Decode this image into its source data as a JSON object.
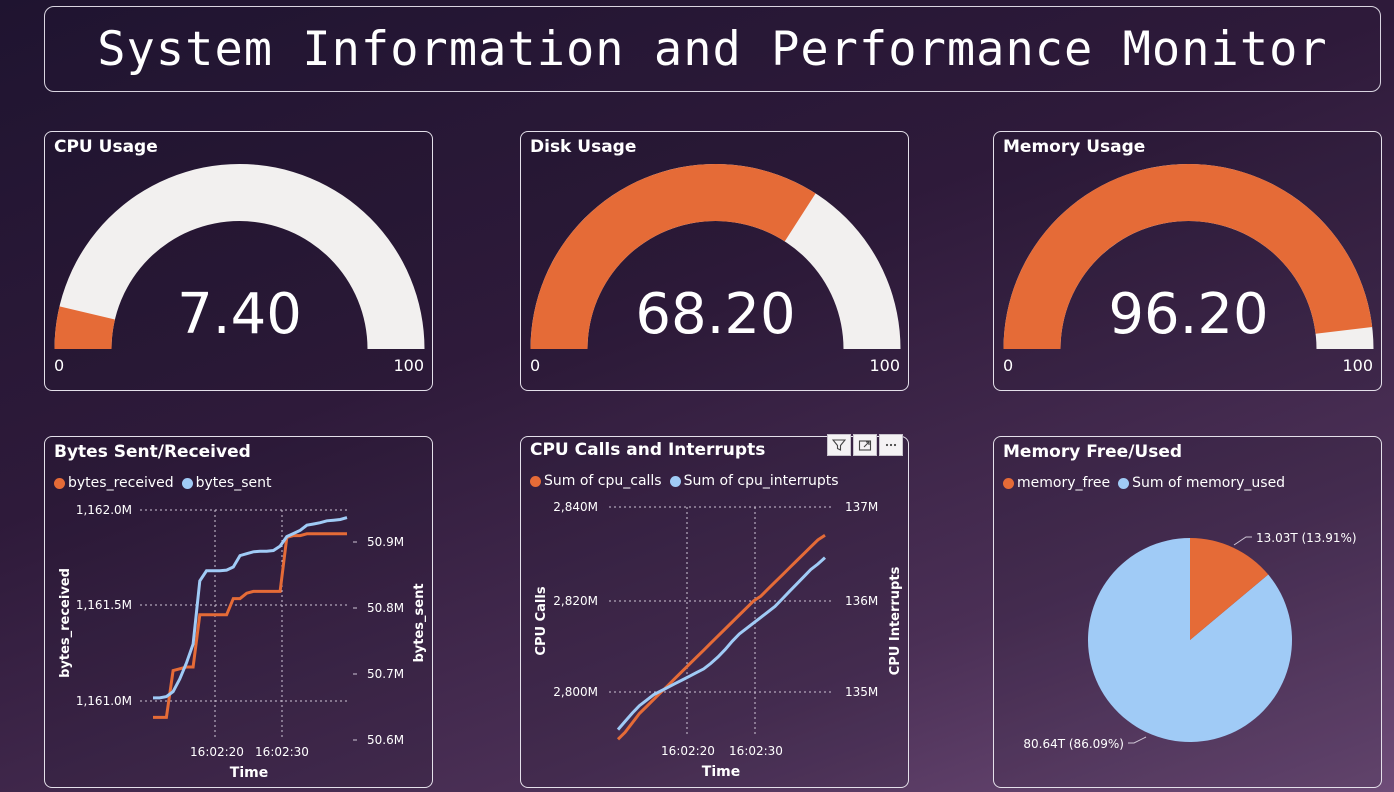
{
  "title": "System Information and Performance Monitor",
  "colors": {
    "orange": "#e56b37",
    "light": "#f2f0ef",
    "blue": "#a0cbf6"
  },
  "gauges": [
    {
      "title": "CPU Usage",
      "value": 7.4,
      "value_text": "7.40",
      "min": "0",
      "max": "100"
    },
    {
      "title": "Disk Usage",
      "value": 68.2,
      "value_text": "68.20",
      "min": "0",
      "max": "100"
    },
    {
      "title": "Memory Usage",
      "value": 96.2,
      "value_text": "96.20",
      "min": "0",
      "max": "100"
    }
  ],
  "bytes_chart": {
    "title": "Bytes Sent/Received",
    "legend": [
      "bytes_received",
      "bytes_sent"
    ],
    "left_ticks": [
      "1,162.0M",
      "1,161.5M",
      "1,161.0M"
    ],
    "right_ticks": [
      "50.9M",
      "50.8M",
      "50.7M",
      "50.6M"
    ],
    "x_ticks": [
      "16:02:20",
      "16:02:30"
    ],
    "xlabel": "Time",
    "ylabel_left": "bytes_received",
    "ylabel_right": "bytes_sent"
  },
  "cpu_chart": {
    "title": "CPU Calls and Interrupts",
    "legend": [
      "Sum of cpu_calls",
      "Sum of cpu_interrupts"
    ],
    "left_ticks": [
      "2,840M",
      "2,820M",
      "2,800M"
    ],
    "right_ticks": [
      "137M",
      "136M",
      "135M"
    ],
    "x_ticks": [
      "16:02:20",
      "16:02:30"
    ],
    "xlabel": "Time",
    "ylabel_left": "CPU Calls",
    "ylabel_right": "CPU Interrupts",
    "toolbar": [
      "filter-icon",
      "focus-mode-icon",
      "more-options-icon"
    ]
  },
  "memory_pie": {
    "title": "Memory Free/Used",
    "legend": [
      "memory_free",
      "Sum of memory_used"
    ],
    "label_free": "13.03T (13.91%)",
    "label_used": "80.64T (86.09%)"
  },
  "chart_data": [
    {
      "type": "line",
      "title": "Bytes Sent/Received",
      "xlabel": "Time",
      "ylabel": "bytes_received",
      "ylabel_right": "bytes_sent",
      "x": [
        0,
        1,
        2,
        3,
        4,
        5,
        6,
        7,
        8,
        9,
        10,
        11,
        12,
        13,
        14,
        15,
        16,
        17,
        18,
        19,
        20,
        21,
        22,
        23,
        24,
        25,
        26,
        27,
        28,
        29
      ],
      "series": [
        {
          "name": "bytes_received",
          "axis": "left",
          "ylim": [
            1160.75,
            1162.05
          ],
          "values": [
            1160.87,
            1160.87,
            1160.87,
            1161.13,
            1161.14,
            1161.15,
            1161.15,
            1161.44,
            1161.44,
            1161.44,
            1161.44,
            1161.44,
            1161.53,
            1161.53,
            1161.56,
            1161.57,
            1161.57,
            1161.57,
            1161.57,
            1161.57,
            1161.87,
            1161.88,
            1161.88,
            1161.89,
            1161.89,
            1161.89,
            1161.89,
            1161.89,
            1161.89,
            1161.89
          ]
        },
        {
          "name": "bytes_sent",
          "axis": "right",
          "ylim": [
            50.58,
            50.95
          ],
          "values": [
            50.645,
            50.645,
            50.647,
            50.655,
            50.675,
            50.7,
            50.73,
            50.83,
            50.846,
            50.846,
            50.846,
            50.847,
            50.852,
            50.87,
            50.873,
            50.876,
            50.877,
            50.877,
            50.878,
            50.885,
            50.9,
            50.905,
            50.91,
            50.918,
            50.92,
            50.922,
            50.925,
            50.926,
            50.927,
            50.93
          ]
        }
      ]
    },
    {
      "type": "line",
      "title": "CPU Calls and Interrupts",
      "xlabel": "Time",
      "ylabel": "CPU Calls",
      "ylabel_right": "CPU Interrupts",
      "x": [
        0,
        1,
        2,
        3,
        4,
        5,
        6,
        7,
        8,
        9,
        10,
        11,
        12,
        13,
        14,
        15,
        16,
        17,
        18,
        19,
        20,
        21,
        22,
        23,
        24,
        25,
        26,
        27,
        28,
        29
      ],
      "series": [
        {
          "name": "Sum of cpu_calls",
          "axis": "left",
          "ylim": [
            2792,
            2841
          ],
          "values": [
            2791.5,
            2793,
            2795,
            2797,
            2798.5,
            2800,
            2801.5,
            2803,
            2804.5,
            2806,
            2807.5,
            2809,
            2810.5,
            2812,
            2813.5,
            2815,
            2816.5,
            2818,
            2819.5,
            2821,
            2822,
            2823.5,
            2825,
            2826.5,
            2828,
            2829.5,
            2831,
            2832.5,
            2834,
            2835
          ]
        },
        {
          "name": "Sum of cpu_interrupts",
          "axis": "right",
          "ylim": [
            134.6,
            137.1
          ],
          "values": [
            134.68,
            134.77,
            134.86,
            134.94,
            135.0,
            135.06,
            135.1,
            135.14,
            135.18,
            135.22,
            135.26,
            135.3,
            135.34,
            135.4,
            135.47,
            135.55,
            135.64,
            135.72,
            135.78,
            135.84,
            135.9,
            135.96,
            136.02,
            136.1,
            136.18,
            136.26,
            136.34,
            136.42,
            136.48,
            136.55
          ]
        }
      ]
    },
    {
      "type": "pie",
      "title": "Memory Free/Used",
      "categories": [
        "memory_free",
        "Sum of memory_used"
      ],
      "values": [
        13.03,
        80.64
      ],
      "labels": [
        "13.03T (13.91%)",
        "80.64T (86.09%)"
      ]
    }
  ]
}
